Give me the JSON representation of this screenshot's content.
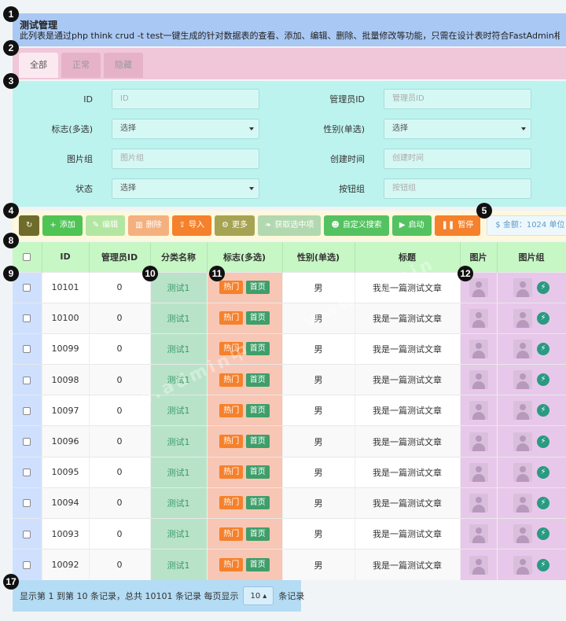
{
  "markers": [
    "1",
    "2",
    "3",
    "4",
    "5",
    "8",
    "9",
    "10",
    "11",
    "12",
    "17"
  ],
  "header": {
    "title": "测试管理",
    "description": "此列表是通过php think crud -t test一键生成的针对数据表的查看、添加、编辑、删除、批量修改等功能，只需在设计表时符合FastAdmin相关字段"
  },
  "tabs": [
    {
      "label": "全部"
    },
    {
      "label": "正常"
    },
    {
      "label": "隐藏"
    }
  ],
  "filter": {
    "id": {
      "label": "ID",
      "placeholder": "ID"
    },
    "admin_id": {
      "label": "管理员ID",
      "placeholder": "管理员ID"
    },
    "flag": {
      "label": "标志(多选)",
      "value": "选择"
    },
    "gender": {
      "label": "性别(单选)",
      "value": "选择"
    },
    "image_group": {
      "label": "图片组",
      "placeholder": "图片组"
    },
    "create_time": {
      "label": "创建时间",
      "placeholder": "创建时间"
    },
    "status": {
      "label": "状态",
      "value": "选择"
    },
    "button_group": {
      "label": "按钮组",
      "placeholder": "按钮组"
    }
  },
  "toolbar": {
    "refresh_icon": "refresh-icon",
    "add": "添加",
    "edit": "编辑",
    "delete": "删除",
    "import": "导入",
    "more": "更多",
    "get_selected": "获取选中项",
    "custom_search": "自定义搜索",
    "start": "启动",
    "pause": "暂停",
    "money": "金额：1024 单位",
    "colors": {
      "refresh": "#6f6b2a",
      "add": "#4ec454",
      "edit": "#b3e6a2",
      "delete": "#f5b080",
      "import": "#f5812c",
      "more": "#a7a354",
      "get_selected": "#b2d8b0",
      "custom_search": "#55c262",
      "start": "#55c262",
      "pause": "#f5812c"
    }
  },
  "table": {
    "columns": [
      "ID",
      "管理员ID",
      "分类名称",
      "标志(多选)",
      "性别(单选)",
      "标题",
      "图片",
      "图片组"
    ],
    "rows": [
      {
        "id": "10101",
        "admin_id": "0",
        "category": "测试1",
        "flags": [
          "热门",
          "首页"
        ],
        "gender": "男",
        "title": "我是一篇测试文章"
      },
      {
        "id": "10100",
        "admin_id": "0",
        "category": "测试1",
        "flags": [
          "热门",
          "首页"
        ],
        "gender": "男",
        "title": "我是一篇测试文章"
      },
      {
        "id": "10099",
        "admin_id": "0",
        "category": "测试1",
        "flags": [
          "热门",
          "首页"
        ],
        "gender": "男",
        "title": "我是一篇测试文章"
      },
      {
        "id": "10098",
        "admin_id": "0",
        "category": "测试1",
        "flags": [
          "热门",
          "首页"
        ],
        "gender": "男",
        "title": "我是一篇测试文章"
      },
      {
        "id": "10097",
        "admin_id": "0",
        "category": "测试1",
        "flags": [
          "热门",
          "首页"
        ],
        "gender": "男",
        "title": "我是一篇测试文章"
      },
      {
        "id": "10096",
        "admin_id": "0",
        "category": "测试1",
        "flags": [
          "热门",
          "首页"
        ],
        "gender": "男",
        "title": "我是一篇测试文章"
      },
      {
        "id": "10095",
        "admin_id": "0",
        "category": "测试1",
        "flags": [
          "热门",
          "首页"
        ],
        "gender": "男",
        "title": "我是一篇测试文章"
      },
      {
        "id": "10094",
        "admin_id": "0",
        "category": "测试1",
        "flags": [
          "热门",
          "首页"
        ],
        "gender": "男",
        "title": "我是一篇测试文章"
      },
      {
        "id": "10093",
        "admin_id": "0",
        "category": "测试1",
        "flags": [
          "热门",
          "首页"
        ],
        "gender": "男",
        "title": "我是一篇测试文章"
      },
      {
        "id": "10092",
        "admin_id": "0",
        "category": "测试1",
        "flags": [
          "热门",
          "首页"
        ],
        "gender": "男",
        "title": "我是一篇测试文章"
      }
    ]
  },
  "footer": {
    "summary": "显示第 1 到第 10 条记录，总共 10101 条记录 每页显示",
    "page_size": "10",
    "suffix": "条记录"
  }
}
